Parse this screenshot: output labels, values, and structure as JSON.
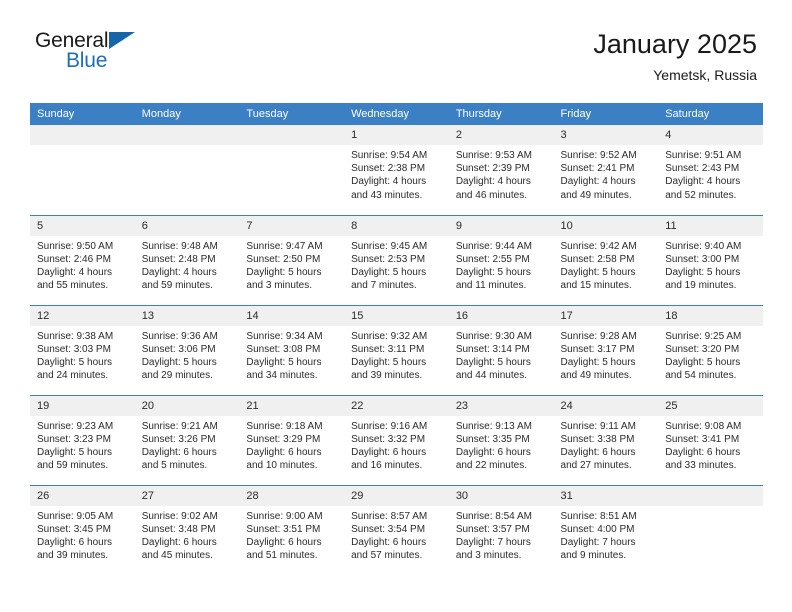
{
  "brand": {
    "line1": "General",
    "line2": "Blue",
    "triangle_color": "#1565a8",
    "blue_color": "#1d6fb8"
  },
  "header": {
    "title": "January 2025",
    "subtitle": "Yemetsk, Russia"
  },
  "theme": {
    "header_bg": "#3b7fc4",
    "daynum_bg": "#f0f0f0",
    "text": "#2b2b2b"
  },
  "weekdays": [
    "Sunday",
    "Monday",
    "Tuesday",
    "Wednesday",
    "Thursday",
    "Friday",
    "Saturday"
  ],
  "weeks": [
    [
      {
        "day": "",
        "empty": true
      },
      {
        "day": "",
        "empty": true
      },
      {
        "day": "",
        "empty": true
      },
      {
        "day": "1",
        "sunrise": "Sunrise: 9:54 AM",
        "sunset": "Sunset: 2:38 PM",
        "daylight1": "Daylight: 4 hours",
        "daylight2": "and 43 minutes."
      },
      {
        "day": "2",
        "sunrise": "Sunrise: 9:53 AM",
        "sunset": "Sunset: 2:39 PM",
        "daylight1": "Daylight: 4 hours",
        "daylight2": "and 46 minutes."
      },
      {
        "day": "3",
        "sunrise": "Sunrise: 9:52 AM",
        "sunset": "Sunset: 2:41 PM",
        "daylight1": "Daylight: 4 hours",
        "daylight2": "and 49 minutes."
      },
      {
        "day": "4",
        "sunrise": "Sunrise: 9:51 AM",
        "sunset": "Sunset: 2:43 PM",
        "daylight1": "Daylight: 4 hours",
        "daylight2": "and 52 minutes."
      }
    ],
    [
      {
        "day": "5",
        "sunrise": "Sunrise: 9:50 AM",
        "sunset": "Sunset: 2:46 PM",
        "daylight1": "Daylight: 4 hours",
        "daylight2": "and 55 minutes."
      },
      {
        "day": "6",
        "sunrise": "Sunrise: 9:48 AM",
        "sunset": "Sunset: 2:48 PM",
        "daylight1": "Daylight: 4 hours",
        "daylight2": "and 59 minutes."
      },
      {
        "day": "7",
        "sunrise": "Sunrise: 9:47 AM",
        "sunset": "Sunset: 2:50 PM",
        "daylight1": "Daylight: 5 hours",
        "daylight2": "and 3 minutes."
      },
      {
        "day": "8",
        "sunrise": "Sunrise: 9:45 AM",
        "sunset": "Sunset: 2:53 PM",
        "daylight1": "Daylight: 5 hours",
        "daylight2": "and 7 minutes."
      },
      {
        "day": "9",
        "sunrise": "Sunrise: 9:44 AM",
        "sunset": "Sunset: 2:55 PM",
        "daylight1": "Daylight: 5 hours",
        "daylight2": "and 11 minutes."
      },
      {
        "day": "10",
        "sunrise": "Sunrise: 9:42 AM",
        "sunset": "Sunset: 2:58 PM",
        "daylight1": "Daylight: 5 hours",
        "daylight2": "and 15 minutes."
      },
      {
        "day": "11",
        "sunrise": "Sunrise: 9:40 AM",
        "sunset": "Sunset: 3:00 PM",
        "daylight1": "Daylight: 5 hours",
        "daylight2": "and 19 minutes."
      }
    ],
    [
      {
        "day": "12",
        "sunrise": "Sunrise: 9:38 AM",
        "sunset": "Sunset: 3:03 PM",
        "daylight1": "Daylight: 5 hours",
        "daylight2": "and 24 minutes."
      },
      {
        "day": "13",
        "sunrise": "Sunrise: 9:36 AM",
        "sunset": "Sunset: 3:06 PM",
        "daylight1": "Daylight: 5 hours",
        "daylight2": "and 29 minutes."
      },
      {
        "day": "14",
        "sunrise": "Sunrise: 9:34 AM",
        "sunset": "Sunset: 3:08 PM",
        "daylight1": "Daylight: 5 hours",
        "daylight2": "and 34 minutes."
      },
      {
        "day": "15",
        "sunrise": "Sunrise: 9:32 AM",
        "sunset": "Sunset: 3:11 PM",
        "daylight1": "Daylight: 5 hours",
        "daylight2": "and 39 minutes."
      },
      {
        "day": "16",
        "sunrise": "Sunrise: 9:30 AM",
        "sunset": "Sunset: 3:14 PM",
        "daylight1": "Daylight: 5 hours",
        "daylight2": "and 44 minutes."
      },
      {
        "day": "17",
        "sunrise": "Sunrise: 9:28 AM",
        "sunset": "Sunset: 3:17 PM",
        "daylight1": "Daylight: 5 hours",
        "daylight2": "and 49 minutes."
      },
      {
        "day": "18",
        "sunrise": "Sunrise: 9:25 AM",
        "sunset": "Sunset: 3:20 PM",
        "daylight1": "Daylight: 5 hours",
        "daylight2": "and 54 minutes."
      }
    ],
    [
      {
        "day": "19",
        "sunrise": "Sunrise: 9:23 AM",
        "sunset": "Sunset: 3:23 PM",
        "daylight1": "Daylight: 5 hours",
        "daylight2": "and 59 minutes."
      },
      {
        "day": "20",
        "sunrise": "Sunrise: 9:21 AM",
        "sunset": "Sunset: 3:26 PM",
        "daylight1": "Daylight: 6 hours",
        "daylight2": "and 5 minutes."
      },
      {
        "day": "21",
        "sunrise": "Sunrise: 9:18 AM",
        "sunset": "Sunset: 3:29 PM",
        "daylight1": "Daylight: 6 hours",
        "daylight2": "and 10 minutes."
      },
      {
        "day": "22",
        "sunrise": "Sunrise: 9:16 AM",
        "sunset": "Sunset: 3:32 PM",
        "daylight1": "Daylight: 6 hours",
        "daylight2": "and 16 minutes."
      },
      {
        "day": "23",
        "sunrise": "Sunrise: 9:13 AM",
        "sunset": "Sunset: 3:35 PM",
        "daylight1": "Daylight: 6 hours",
        "daylight2": "and 22 minutes."
      },
      {
        "day": "24",
        "sunrise": "Sunrise: 9:11 AM",
        "sunset": "Sunset: 3:38 PM",
        "daylight1": "Daylight: 6 hours",
        "daylight2": "and 27 minutes."
      },
      {
        "day": "25",
        "sunrise": "Sunrise: 9:08 AM",
        "sunset": "Sunset: 3:41 PM",
        "daylight1": "Daylight: 6 hours",
        "daylight2": "and 33 minutes."
      }
    ],
    [
      {
        "day": "26",
        "sunrise": "Sunrise: 9:05 AM",
        "sunset": "Sunset: 3:45 PM",
        "daylight1": "Daylight: 6 hours",
        "daylight2": "and 39 minutes."
      },
      {
        "day": "27",
        "sunrise": "Sunrise: 9:02 AM",
        "sunset": "Sunset: 3:48 PM",
        "daylight1": "Daylight: 6 hours",
        "daylight2": "and 45 minutes."
      },
      {
        "day": "28",
        "sunrise": "Sunrise: 9:00 AM",
        "sunset": "Sunset: 3:51 PM",
        "daylight1": "Daylight: 6 hours",
        "daylight2": "and 51 minutes."
      },
      {
        "day": "29",
        "sunrise": "Sunrise: 8:57 AM",
        "sunset": "Sunset: 3:54 PM",
        "daylight1": "Daylight: 6 hours",
        "daylight2": "and 57 minutes."
      },
      {
        "day": "30",
        "sunrise": "Sunrise: 8:54 AM",
        "sunset": "Sunset: 3:57 PM",
        "daylight1": "Daylight: 7 hours",
        "daylight2": "and 3 minutes."
      },
      {
        "day": "31",
        "sunrise": "Sunrise: 8:51 AM",
        "sunset": "Sunset: 4:00 PM",
        "daylight1": "Daylight: 7 hours",
        "daylight2": "and 9 minutes."
      },
      {
        "day": "",
        "empty": true
      }
    ]
  ]
}
